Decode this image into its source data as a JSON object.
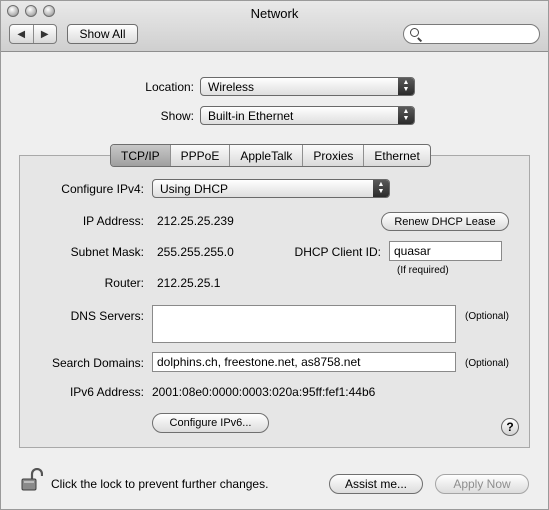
{
  "window": {
    "title": "Network"
  },
  "toolbar": {
    "back_label": "◀",
    "forward_label": "▶",
    "show_all_label": "Show All",
    "search_placeholder": ""
  },
  "location": {
    "label": "Location:",
    "value": "Wireless"
  },
  "show": {
    "label": "Show:",
    "value": "Built-in Ethernet"
  },
  "tabs": [
    "TCP/IP",
    "PPPoE",
    "AppleTalk",
    "Proxies",
    "Ethernet"
  ],
  "tcpip": {
    "configure_label": "Configure IPv4:",
    "configure_value": "Using DHCP",
    "ip_label": "IP Address:",
    "ip_value": "212.25.25.239",
    "renew_label": "Renew DHCP Lease",
    "subnet_label": "Subnet Mask:",
    "subnet_value": "255.255.255.0",
    "client_id_label": "DHCP Client ID:",
    "client_id_value": "quasar",
    "client_id_hint": "(If required)",
    "router_label": "Router:",
    "router_value": "212.25.25.1",
    "dns_label": "DNS Servers:",
    "dns_value": "",
    "optional": "(Optional)",
    "search_label": "Search Domains:",
    "search_value": "dolphins.ch, freestone.net, as8758.net",
    "ipv6_label": "IPv6 Address:",
    "ipv6_value": "2001:08e0:0000:0003:020a:95ff:fef1:44b6",
    "configure_ipv6_label": "Configure IPv6...",
    "help_label": "?"
  },
  "footer": {
    "lock_text": "Click the lock to prevent further changes.",
    "assist_label": "Assist me...",
    "apply_label": "Apply Now"
  }
}
